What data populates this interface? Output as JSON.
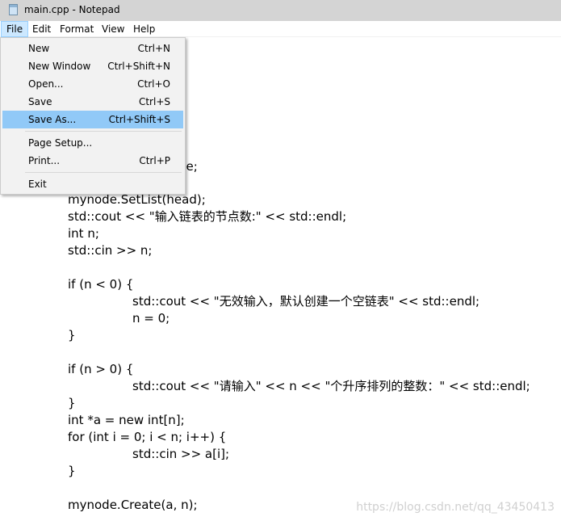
{
  "window": {
    "title": "main.cpp - Notepad",
    "icon": "notepad-icon"
  },
  "menubar": [
    {
      "label": "File",
      "active": true
    },
    {
      "label": "Edit"
    },
    {
      "label": "Format"
    },
    {
      "label": "View"
    },
    {
      "label": "Help"
    }
  ],
  "file_menu": {
    "items": [
      {
        "label": "New",
        "shortcut": "Ctrl+N"
      },
      {
        "label": "New Window",
        "shortcut": "Ctrl+Shift+N"
      },
      {
        "label": "Open...",
        "shortcut": "Ctrl+O"
      },
      {
        "label": "Save",
        "shortcut": "Ctrl+S"
      },
      {
        "label": "Save As...",
        "shortcut": "Ctrl+Shift+S",
        "highlighted": true
      },
      {
        "label": "Page Setup...",
        "shortcut": ""
      },
      {
        "label": "Print...",
        "shortcut": "Ctrl+P"
      },
      {
        "label": "Exit",
        "shortcut": ""
      }
    ]
  },
  "editor": {
    "lines": [
      "de;",
      "mynode.SetList(head);",
      "std::cout << \"输入链表的节点数:\" << std::endl;",
      "int n;",
      "std::cin >> n;",
      "if (n < 0) {",
      "std::cout << \"无效输入，默认创建一个空链表\" << std::endl;",
      "n = 0;",
      "}",
      "if (n > 0) {",
      "std::cout << \"请输入\" << n << \"个升序排列的整数：\" << std::endl;",
      "}",
      "int *a = new int[n];",
      "for (int i = 0; i < n; i++) {",
      "std::cin >> a[i];",
      "}",
      "mynode.Create(a, n);"
    ]
  },
  "watermark": "https://blog.csdn.net/qq_43450413",
  "colors": {
    "menu_highlight": "#91c9f7",
    "menubar_active": "#cce8ff",
    "titlebar": "#d4d4d4"
  }
}
